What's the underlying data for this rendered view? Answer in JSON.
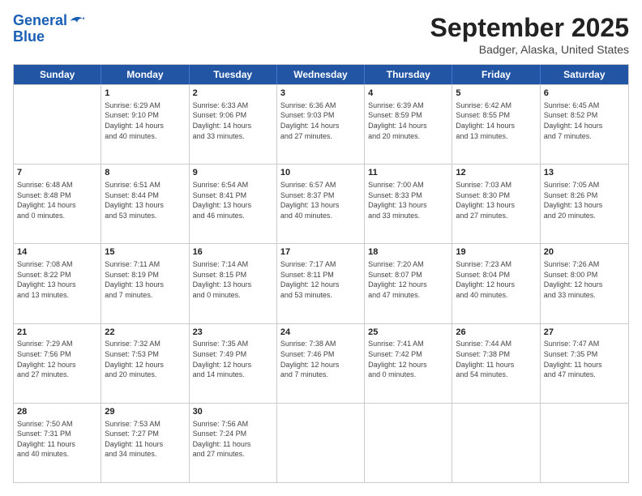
{
  "header": {
    "logo_line1": "General",
    "logo_line2": "Blue",
    "title": "September 2025",
    "subtitle": "Badger, Alaska, United States"
  },
  "weekdays": [
    "Sunday",
    "Monday",
    "Tuesday",
    "Wednesday",
    "Thursday",
    "Friday",
    "Saturday"
  ],
  "weeks": [
    [
      {
        "day": "",
        "info": ""
      },
      {
        "day": "1",
        "info": "Sunrise: 6:29 AM\nSunset: 9:10 PM\nDaylight: 14 hours\nand 40 minutes."
      },
      {
        "day": "2",
        "info": "Sunrise: 6:33 AM\nSunset: 9:06 PM\nDaylight: 14 hours\nand 33 minutes."
      },
      {
        "day": "3",
        "info": "Sunrise: 6:36 AM\nSunset: 9:03 PM\nDaylight: 14 hours\nand 27 minutes."
      },
      {
        "day": "4",
        "info": "Sunrise: 6:39 AM\nSunset: 8:59 PM\nDaylight: 14 hours\nand 20 minutes."
      },
      {
        "day": "5",
        "info": "Sunrise: 6:42 AM\nSunset: 8:55 PM\nDaylight: 14 hours\nand 13 minutes."
      },
      {
        "day": "6",
        "info": "Sunrise: 6:45 AM\nSunset: 8:52 PM\nDaylight: 14 hours\nand 7 minutes."
      }
    ],
    [
      {
        "day": "7",
        "info": "Sunrise: 6:48 AM\nSunset: 8:48 PM\nDaylight: 14 hours\nand 0 minutes."
      },
      {
        "day": "8",
        "info": "Sunrise: 6:51 AM\nSunset: 8:44 PM\nDaylight: 13 hours\nand 53 minutes."
      },
      {
        "day": "9",
        "info": "Sunrise: 6:54 AM\nSunset: 8:41 PM\nDaylight: 13 hours\nand 46 minutes."
      },
      {
        "day": "10",
        "info": "Sunrise: 6:57 AM\nSunset: 8:37 PM\nDaylight: 13 hours\nand 40 minutes."
      },
      {
        "day": "11",
        "info": "Sunrise: 7:00 AM\nSunset: 8:33 PM\nDaylight: 13 hours\nand 33 minutes."
      },
      {
        "day": "12",
        "info": "Sunrise: 7:03 AM\nSunset: 8:30 PM\nDaylight: 13 hours\nand 27 minutes."
      },
      {
        "day": "13",
        "info": "Sunrise: 7:05 AM\nSunset: 8:26 PM\nDaylight: 13 hours\nand 20 minutes."
      }
    ],
    [
      {
        "day": "14",
        "info": "Sunrise: 7:08 AM\nSunset: 8:22 PM\nDaylight: 13 hours\nand 13 minutes."
      },
      {
        "day": "15",
        "info": "Sunrise: 7:11 AM\nSunset: 8:19 PM\nDaylight: 13 hours\nand 7 minutes."
      },
      {
        "day": "16",
        "info": "Sunrise: 7:14 AM\nSunset: 8:15 PM\nDaylight: 13 hours\nand 0 minutes."
      },
      {
        "day": "17",
        "info": "Sunrise: 7:17 AM\nSunset: 8:11 PM\nDaylight: 12 hours\nand 53 minutes."
      },
      {
        "day": "18",
        "info": "Sunrise: 7:20 AM\nSunset: 8:07 PM\nDaylight: 12 hours\nand 47 minutes."
      },
      {
        "day": "19",
        "info": "Sunrise: 7:23 AM\nSunset: 8:04 PM\nDaylight: 12 hours\nand 40 minutes."
      },
      {
        "day": "20",
        "info": "Sunrise: 7:26 AM\nSunset: 8:00 PM\nDaylight: 12 hours\nand 33 minutes."
      }
    ],
    [
      {
        "day": "21",
        "info": "Sunrise: 7:29 AM\nSunset: 7:56 PM\nDaylight: 12 hours\nand 27 minutes."
      },
      {
        "day": "22",
        "info": "Sunrise: 7:32 AM\nSunset: 7:53 PM\nDaylight: 12 hours\nand 20 minutes."
      },
      {
        "day": "23",
        "info": "Sunrise: 7:35 AM\nSunset: 7:49 PM\nDaylight: 12 hours\nand 14 minutes."
      },
      {
        "day": "24",
        "info": "Sunrise: 7:38 AM\nSunset: 7:46 PM\nDaylight: 12 hours\nand 7 minutes."
      },
      {
        "day": "25",
        "info": "Sunrise: 7:41 AM\nSunset: 7:42 PM\nDaylight: 12 hours\nand 0 minutes."
      },
      {
        "day": "26",
        "info": "Sunrise: 7:44 AM\nSunset: 7:38 PM\nDaylight: 11 hours\nand 54 minutes."
      },
      {
        "day": "27",
        "info": "Sunrise: 7:47 AM\nSunset: 7:35 PM\nDaylight: 11 hours\nand 47 minutes."
      }
    ],
    [
      {
        "day": "28",
        "info": "Sunrise: 7:50 AM\nSunset: 7:31 PM\nDaylight: 11 hours\nand 40 minutes."
      },
      {
        "day": "29",
        "info": "Sunrise: 7:53 AM\nSunset: 7:27 PM\nDaylight: 11 hours\nand 34 minutes."
      },
      {
        "day": "30",
        "info": "Sunrise: 7:56 AM\nSunset: 7:24 PM\nDaylight: 11 hours\nand 27 minutes."
      },
      {
        "day": "",
        "info": ""
      },
      {
        "day": "",
        "info": ""
      },
      {
        "day": "",
        "info": ""
      },
      {
        "day": "",
        "info": ""
      }
    ]
  ]
}
